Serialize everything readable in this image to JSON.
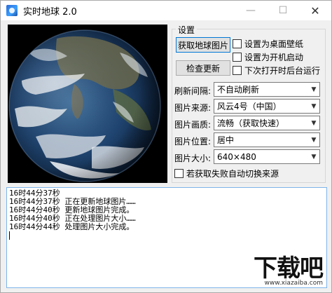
{
  "window": {
    "title": "实时地球 2.0",
    "controls": {
      "minimize": "—",
      "maximize": "☐",
      "close": "✕"
    }
  },
  "settings": {
    "group_title": "设置",
    "fetch_button": "获取地球图片",
    "update_button": "检查更新",
    "checkboxes": [
      {
        "label": "设置为桌面壁纸",
        "checked": false
      },
      {
        "label": "设置为开机启动",
        "checked": false
      },
      {
        "label": "下次打开时后台运行",
        "checked": false
      }
    ],
    "fields": [
      {
        "label": "刷新间隔:",
        "value": "不自动刷新"
      },
      {
        "label": "图片来源:",
        "value": "风云4号（中国）"
      },
      {
        "label": "图片画质:",
        "value": "流畅（获取快速）"
      },
      {
        "label": "图片位置:",
        "value": "居中"
      },
      {
        "label": "图片大小:",
        "value": "640×480"
      }
    ],
    "auto_switch": {
      "label": "若获取失败自动切换来源",
      "checked": false
    }
  },
  "log": {
    "lines": [
      "16时44分37秒",
      "16时44分37秒 正在更新地球图片……",
      "16时44分40秒 更新地球图片完成。",
      "16时44分40秒 正在处理图片大小……",
      "16时44分44秒 处理图片大小完成。"
    ]
  },
  "watermark": {
    "big": "下载吧",
    "small": "www.xiazaiba.com"
  }
}
